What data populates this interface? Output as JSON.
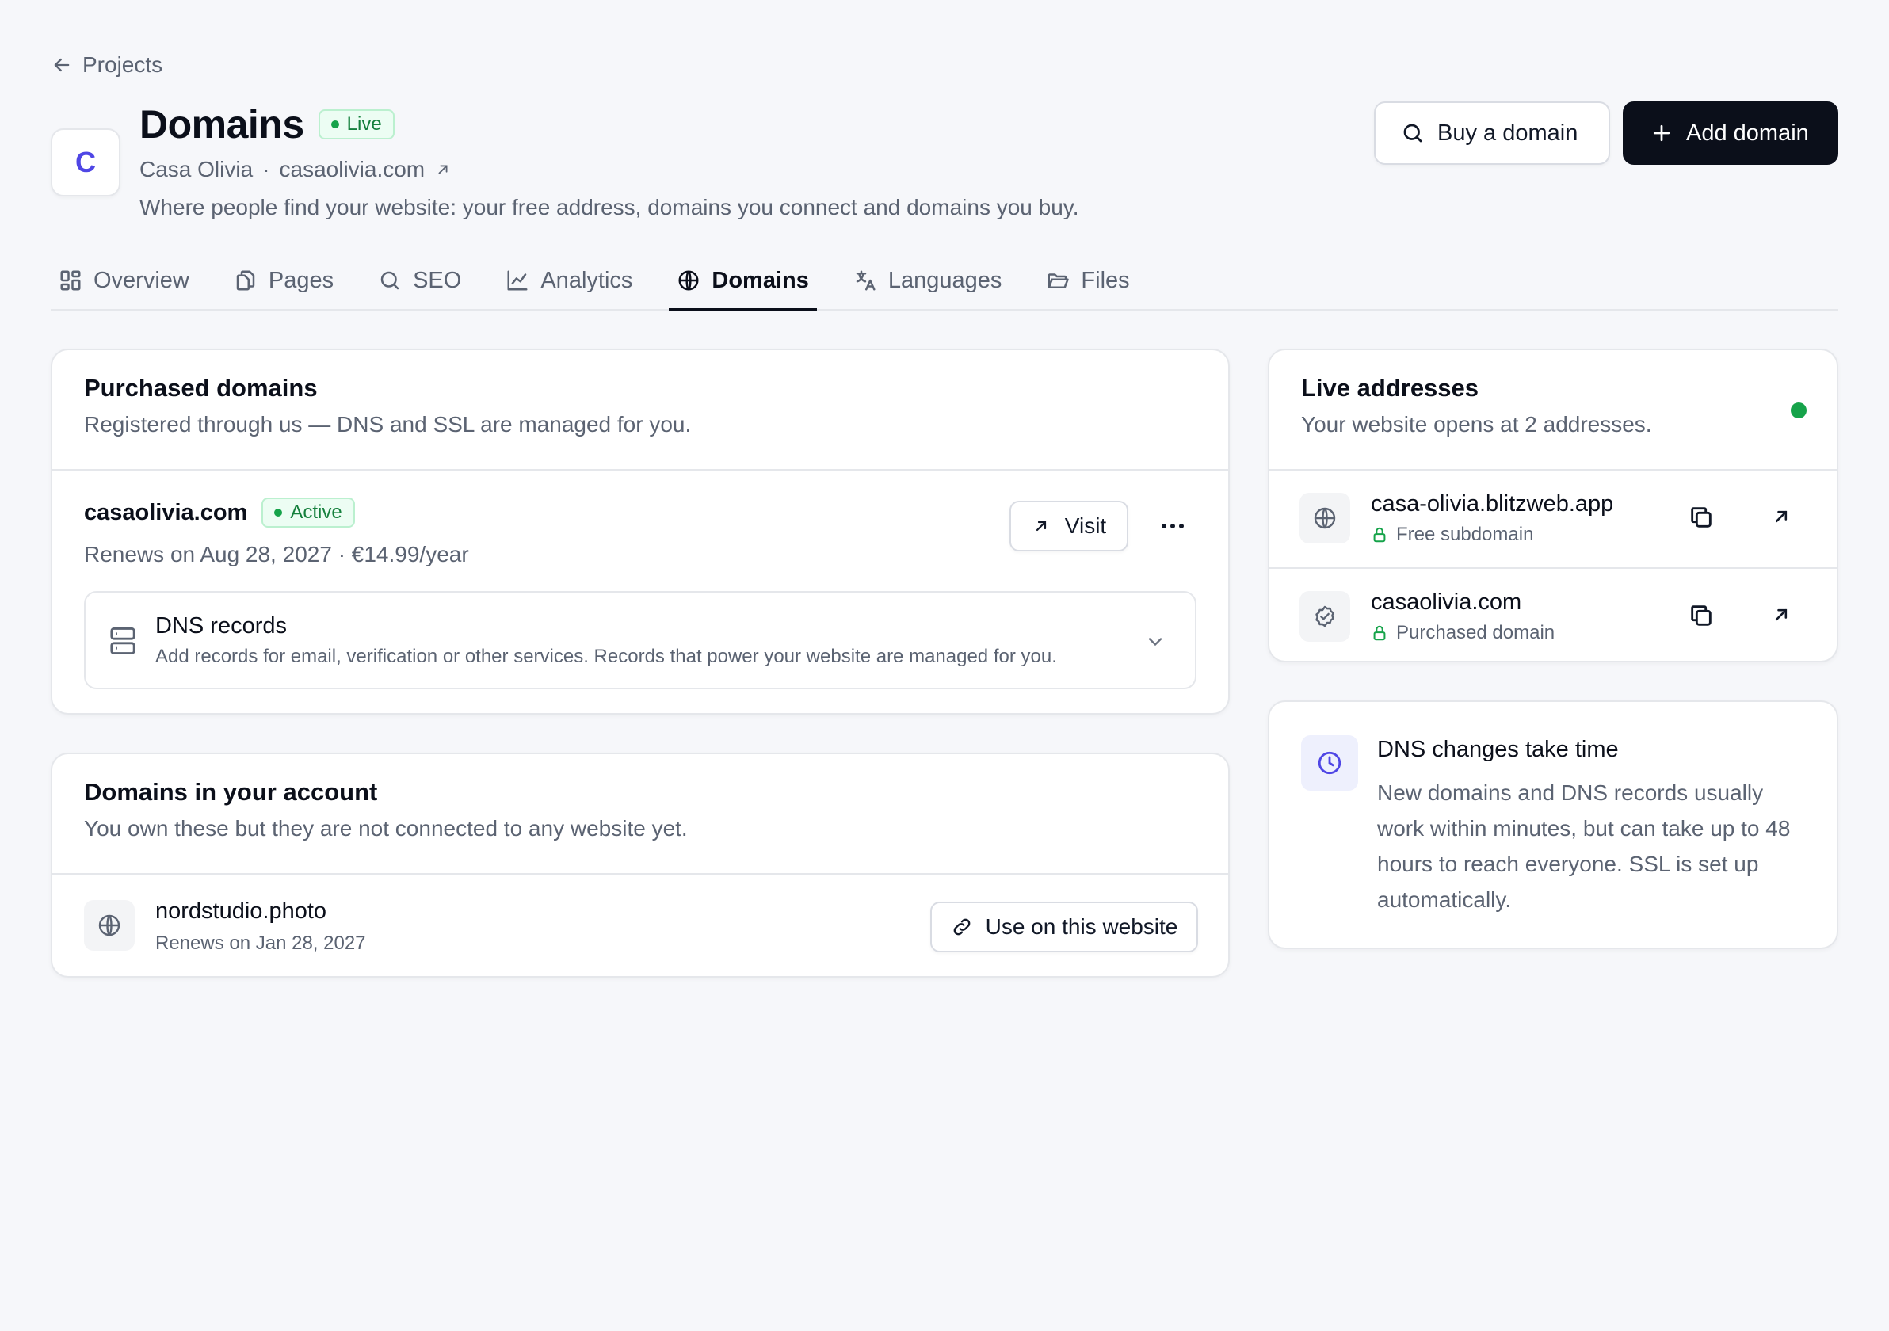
{
  "back": {
    "label": "Projects"
  },
  "header": {
    "avatar_letter": "C",
    "title": "Domains",
    "status_badge": "Live",
    "project_name": "Casa Olivia",
    "separator": "·",
    "project_domain": "casaolivia.com",
    "description": "Where people find your website: your free address, domains you connect and domains you buy.",
    "buy_button": "Buy a domain",
    "add_button": "Add domain"
  },
  "tabs": [
    {
      "label": "Overview",
      "icon": "overview-grid-icon"
    },
    {
      "label": "Pages",
      "icon": "pages-icon"
    },
    {
      "label": "SEO",
      "icon": "search-icon"
    },
    {
      "label": "Analytics",
      "icon": "chart-icon"
    },
    {
      "label": "Domains",
      "icon": "globe-icon",
      "active": true
    },
    {
      "label": "Languages",
      "icon": "translate-icon"
    },
    {
      "label": "Files",
      "icon": "folder-icon"
    }
  ],
  "purchased": {
    "title": "Purchased domains",
    "subtitle": "Registered through us — DNS and SSL are managed for you.",
    "domain": {
      "name": "casaolivia.com",
      "status": "Active",
      "meta": "Renews on Aug 28, 2027 · €14.99/year",
      "visit_label": "Visit"
    },
    "dns": {
      "title": "DNS records",
      "subtitle": "Add records for email, verification or other services. Records that power your website are managed for you."
    }
  },
  "account": {
    "title": "Domains in your account",
    "subtitle": "You own these but they are not connected to any website yet.",
    "domain": {
      "name": "nordstudio.photo",
      "meta": "Renews on Jan 28, 2027",
      "use_label": "Use on this website"
    }
  },
  "live": {
    "title": "Live addresses",
    "subtitle": "Your website opens at 2 addresses.",
    "status_color": "#16a34a",
    "addresses": [
      {
        "name": "casa-olivia.blitzweb.app",
        "meta": "Free subdomain",
        "icon": "globe-icon"
      },
      {
        "name": "casaolivia.com",
        "meta": "Purchased domain",
        "icon": "verified-check-icon"
      }
    ]
  },
  "tip": {
    "title": "DNS changes take time",
    "body": "New domains and DNS records usually work within minutes, but can take up to 48 hours to reach everyone. SSL is set up automatically."
  },
  "colors": {
    "accent": "#4f46e5",
    "primary": "#0b0f1a",
    "success": "#16a34a"
  }
}
